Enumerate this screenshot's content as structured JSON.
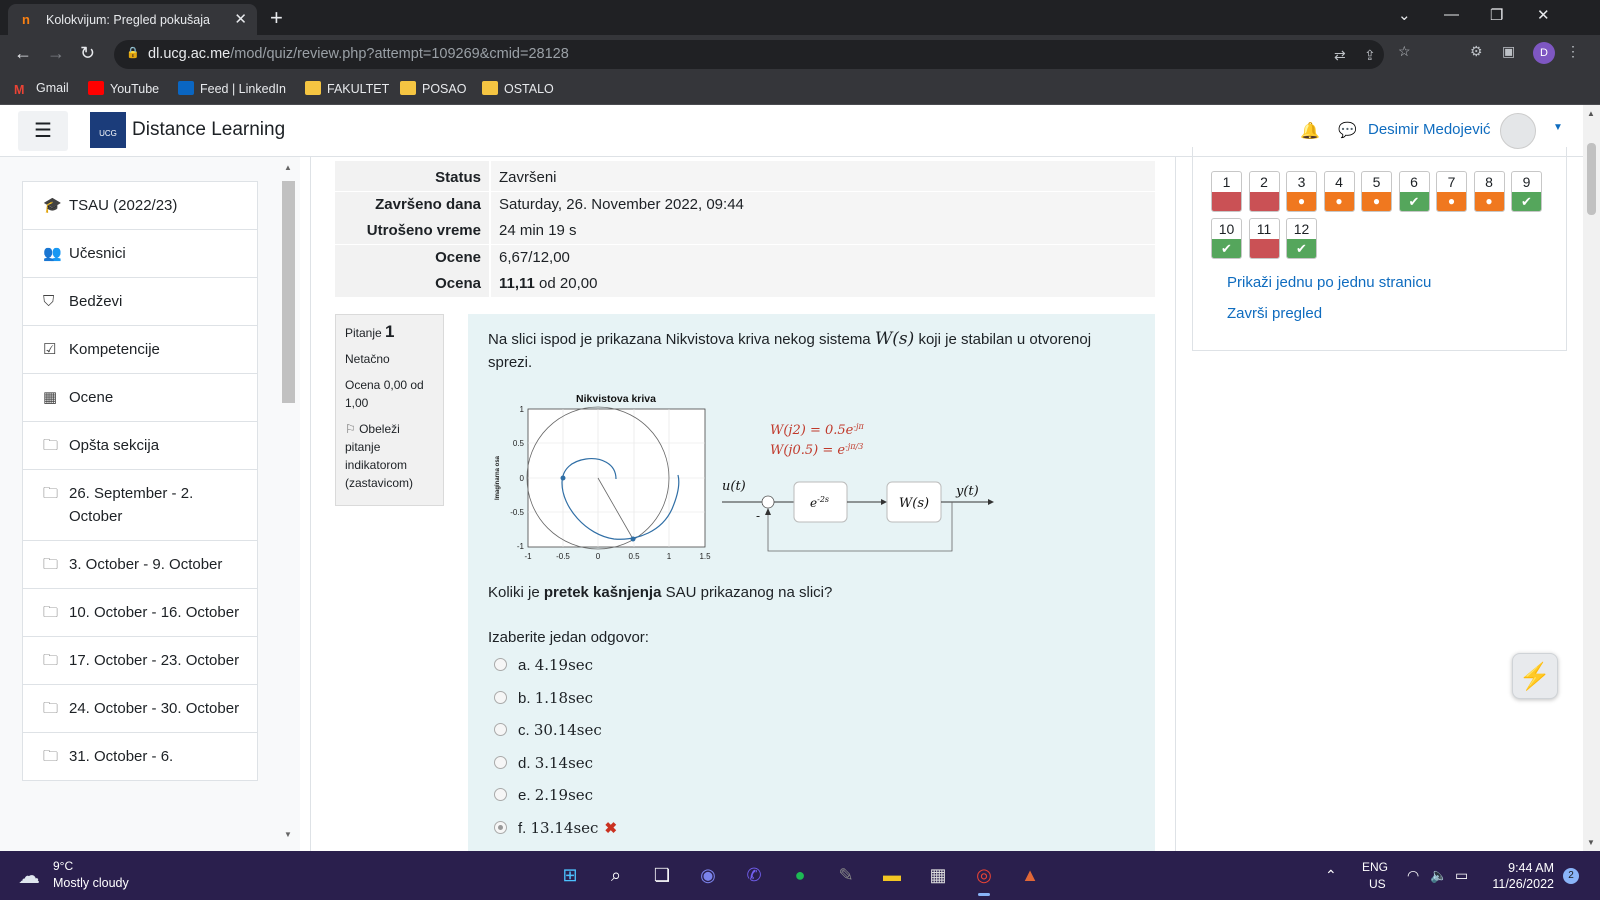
{
  "browser": {
    "tab_title": "Kolokvijum: Pregled pokušaja",
    "tab_favicon": "n",
    "url_host": "dl.ucg.ac.me",
    "url_path": "/mod/quiz/review.php?attempt=109269&cmid=28128",
    "profile_initial": "D",
    "bookmarks": [
      "Gmail",
      "YouTube",
      "Feed | LinkedIn",
      "FAKULTET",
      "POSAO",
      "OSTALO"
    ]
  },
  "header": {
    "site_name": "Distance Learning",
    "logo_text": "UCG",
    "user_name": "Desimir Medojević"
  },
  "sidebar": {
    "items": [
      {
        "icon": "graduation-cap-icon",
        "glyph": "🎓",
        "label": "TSAU (2022/23)"
      },
      {
        "icon": "users-icon",
        "glyph": "👥",
        "label": "Učesnici"
      },
      {
        "icon": "shield-icon",
        "glyph": "⛉",
        "label": "Bedževi"
      },
      {
        "icon": "check-square-icon",
        "glyph": "☑",
        "label": "Kompetencije"
      },
      {
        "icon": "table-icon",
        "glyph": "▦",
        "label": "Ocene"
      },
      {
        "icon": "folder-icon",
        "glyph": "🗀",
        "label": "Opšta sekcija"
      },
      {
        "icon": "folder-icon",
        "glyph": "🗀",
        "label": "26. September - 2. October"
      },
      {
        "icon": "folder-icon",
        "glyph": "🗀",
        "label": "3. October - 9. October"
      },
      {
        "icon": "folder-icon",
        "glyph": "🗀",
        "label": "10. October - 16. October"
      },
      {
        "icon": "folder-icon",
        "glyph": "🗀",
        "label": "17. October - 23. October"
      },
      {
        "icon": "folder-icon",
        "glyph": "🗀",
        "label": "24. October - 30. October"
      },
      {
        "icon": "folder-icon",
        "glyph": "🗀",
        "label": "31. October - 6."
      }
    ]
  },
  "summary": {
    "rows": [
      {
        "key": "Status",
        "value": "Završeni"
      },
      {
        "key": "Završeno dana",
        "value": "Saturday, 26. November 2022, 09:44"
      },
      {
        "key": "Utrošeno vreme",
        "value": "24 min 19 s"
      },
      {
        "key": "Ocene",
        "value": "6,67/12,00"
      },
      {
        "key": "Ocena",
        "value_bold": "11,11",
        "value": " od 20,00"
      }
    ]
  },
  "question_info": {
    "label": "Pitanje",
    "number": "1",
    "state": "Netačno",
    "grade": "Ocena 0,00 od 1,00",
    "flag_text": "Obeleži pitanje indikatorom (zastavicom)"
  },
  "question": {
    "text_before": "Na slici ispod je prikazana Nikvistova kriva nekog sistema ",
    "text_math": "W(s)",
    "text_after": " koji je stabilan u otvorenoj sprezi.",
    "figure": {
      "plot_title": "Nikvistova kriva",
      "y_axis_label": "Imaginarna osa",
      "x_ticks": [
        "-1",
        "-0.5",
        "0",
        "0.5",
        "1",
        "1.5"
      ],
      "y_ticks": [
        "1",
        "0.5",
        "0",
        "-0.5",
        "-1"
      ],
      "eq1": "W(j2) = 0.5e",
      "eq1_exp": "-jπ",
      "eq2": "W(j0.5) = e",
      "eq2_exp": "-jπ/3",
      "input_label": "u(t)",
      "output_label": "y(t)",
      "delay_block": "e",
      "delay_exp": "-2s",
      "plant_block": "W(s)",
      "minus_sign": "-"
    },
    "prompt_pre": "Koliki je ",
    "prompt_bold": "pretek kašnjenja",
    "prompt_post": " SAU prikazanog na slici?",
    "choose_label": "Izaberite jedan odgovor:",
    "answers": [
      {
        "letter": "a.",
        "value": "4.19sec",
        "selected": false
      },
      {
        "letter": "b.",
        "value": "1.18sec",
        "selected": false
      },
      {
        "letter": "c.",
        "value": "30.14sec",
        "selected": false
      },
      {
        "letter": "d.",
        "value": "3.14sec",
        "selected": false
      },
      {
        "letter": "e.",
        "value": "2.19sec",
        "selected": false
      },
      {
        "letter": "f.",
        "value": "13.14sec",
        "selected": true,
        "mark": "✖"
      }
    ]
  },
  "quiz_nav": {
    "buttons": [
      {
        "n": "1",
        "state": "incorrect"
      },
      {
        "n": "2",
        "state": "incorrect"
      },
      {
        "n": "3",
        "state": "partial"
      },
      {
        "n": "4",
        "state": "partial"
      },
      {
        "n": "5",
        "state": "partial"
      },
      {
        "n": "6",
        "state": "correct"
      },
      {
        "n": "7",
        "state": "partial"
      },
      {
        "n": "8",
        "state": "partial"
      },
      {
        "n": "9",
        "state": "correct"
      },
      {
        "n": "10",
        "state": "correct"
      },
      {
        "n": "11",
        "state": "incorrect"
      },
      {
        "n": "12",
        "state": "correct"
      }
    ],
    "link_one_page": "Prikaži jednu po jednu stranicu",
    "link_finish": "Završi pregled"
  },
  "taskbar": {
    "temperature": "9°C",
    "weather": "Mostly cloudy",
    "lang1": "ENG",
    "lang2": "US",
    "time": "9:44 AM",
    "date": "11/26/2022",
    "notifications": "2"
  },
  "colors": {
    "link": "#0f6cbf",
    "incorrect": "#ca5155",
    "partial": "#f0781f",
    "correct": "#55a65c",
    "question_bg": "#e7f3f5"
  }
}
